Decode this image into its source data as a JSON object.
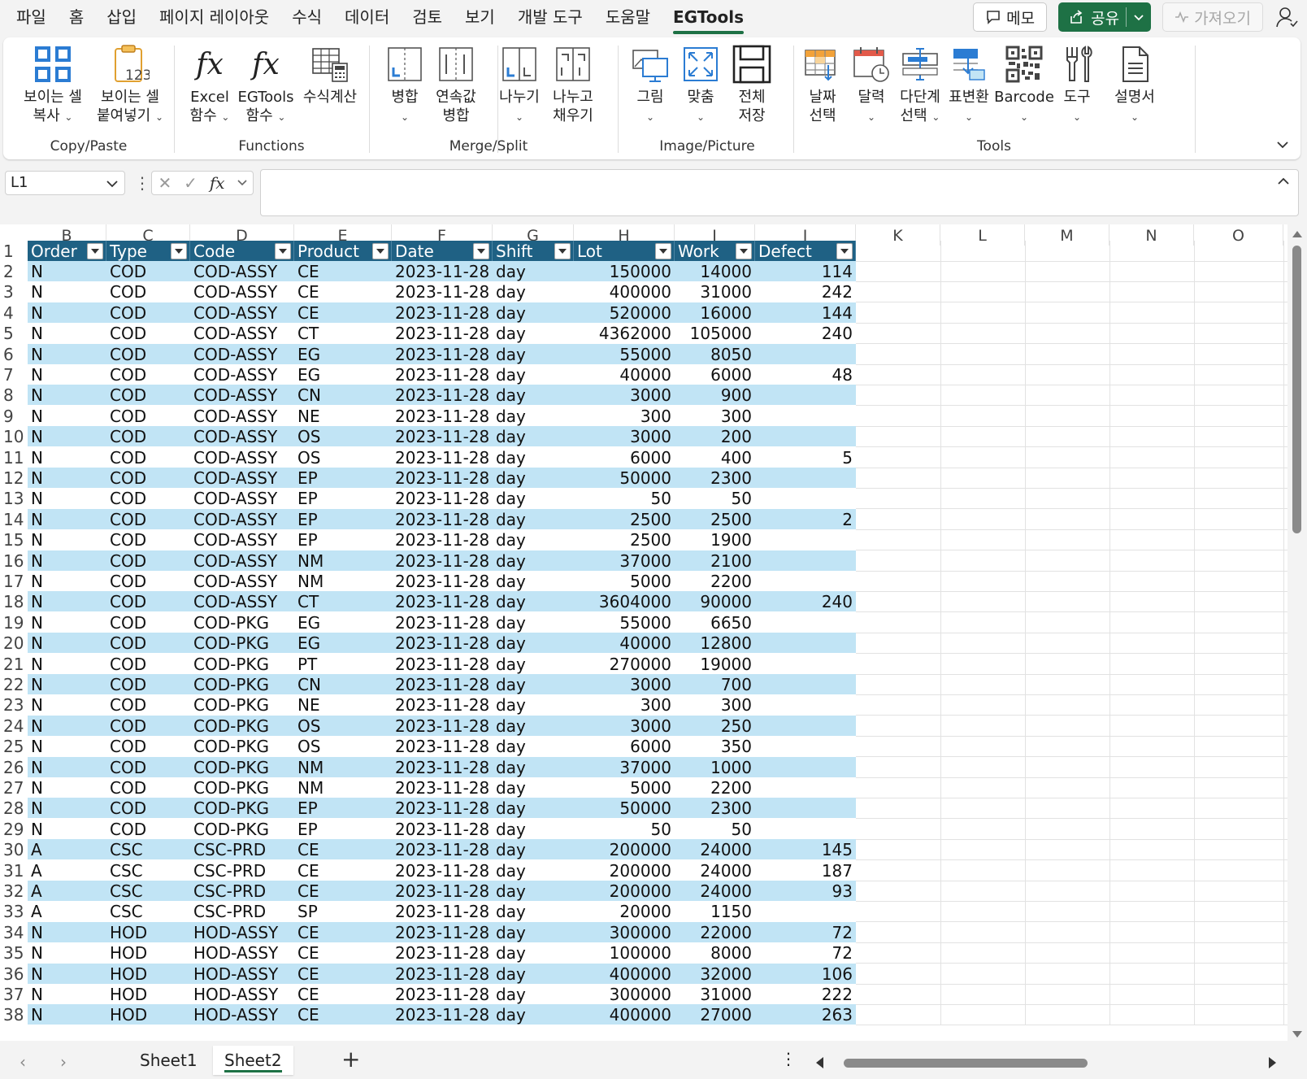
{
  "menu": {
    "tabs": [
      "파일",
      "홈",
      "삽입",
      "페이지 레이아웃",
      "수식",
      "데이터",
      "검토",
      "보기",
      "개발 도구",
      "도움말",
      "EGTools"
    ],
    "active": "EGTools",
    "memo": "메모",
    "share": "공유",
    "import": "가져오기"
  },
  "ribbon": {
    "groups": {
      "copy_paste": "Copy/Paste",
      "functions": "Functions",
      "merge_split": "Merge/Split",
      "image_picture": "Image/Picture",
      "tools": "Tools"
    },
    "buttons": {
      "copy_visible_1": "보이는 셀",
      "copy_visible_2": "복사",
      "paste_visible_1": "보이는 셀",
      "paste_visible_2": "붙여넣기",
      "excel_fn_1": "Excel",
      "excel_fn_2": "함수",
      "egtools_fn_1": "EGTools",
      "egtools_fn_2": "함수",
      "calc": "수식계산",
      "merge": "병합",
      "merge_series_1": "연속값",
      "merge_series_2": "병합",
      "split": "나누기",
      "split_fill_1": "나누고",
      "split_fill_2": "채우기",
      "picture": "그림",
      "fit": "맞춤",
      "save_all_1": "전체",
      "save_all_2": "저장",
      "date_pick_1": "날짜",
      "date_pick_2": "선택",
      "calendar": "달력",
      "multilevel_1": "다단계",
      "multilevel_2": "선택",
      "table_convert": "표변환",
      "barcode": "Barcode",
      "tool": "도구",
      "manual": "설명서"
    }
  },
  "formula_bar": {
    "name_box": "L1",
    "value": ""
  },
  "grid": {
    "columns": [
      "B",
      "C",
      "D",
      "E",
      "F",
      "G",
      "H",
      "I",
      "J",
      "K",
      "L",
      "M",
      "N",
      "O"
    ],
    "header_row_num": "1",
    "headers": [
      "Order",
      "Type",
      "Code",
      "Product",
      "Date",
      "Shift",
      "Lot",
      "Work",
      "Defect"
    ],
    "rows": [
      {
        "n": "2",
        "order": "N",
        "type": "COD",
        "code": "COD-ASSY",
        "product": "CE",
        "date": "2023-11-28",
        "shift": "day",
        "lot": "150000",
        "work": "14000",
        "defect": "114"
      },
      {
        "n": "3",
        "order": "N",
        "type": "COD",
        "code": "COD-ASSY",
        "product": "CE",
        "date": "2023-11-28",
        "shift": "day",
        "lot": "400000",
        "work": "31000",
        "defect": "242"
      },
      {
        "n": "4",
        "order": "N",
        "type": "COD",
        "code": "COD-ASSY",
        "product": "CE",
        "date": "2023-11-28",
        "shift": "day",
        "lot": "520000",
        "work": "16000",
        "defect": "144"
      },
      {
        "n": "5",
        "order": "N",
        "type": "COD",
        "code": "COD-ASSY",
        "product": "CT",
        "date": "2023-11-28",
        "shift": "day",
        "lot": "4362000",
        "work": "105000",
        "defect": "240"
      },
      {
        "n": "6",
        "order": "N",
        "type": "COD",
        "code": "COD-ASSY",
        "product": "EG",
        "date": "2023-11-28",
        "shift": "day",
        "lot": "55000",
        "work": "8050",
        "defect": ""
      },
      {
        "n": "7",
        "order": "N",
        "type": "COD",
        "code": "COD-ASSY",
        "product": "EG",
        "date": "2023-11-28",
        "shift": "day",
        "lot": "40000",
        "work": "6000",
        "defect": "48"
      },
      {
        "n": "8",
        "order": "N",
        "type": "COD",
        "code": "COD-ASSY",
        "product": "CN",
        "date": "2023-11-28",
        "shift": "day",
        "lot": "3000",
        "work": "900",
        "defect": ""
      },
      {
        "n": "9",
        "order": "N",
        "type": "COD",
        "code": "COD-ASSY",
        "product": "NE",
        "date": "2023-11-28",
        "shift": "day",
        "lot": "300",
        "work": "300",
        "defect": ""
      },
      {
        "n": "10",
        "order": "N",
        "type": "COD",
        "code": "COD-ASSY",
        "product": "OS",
        "date": "2023-11-28",
        "shift": "day",
        "lot": "3000",
        "work": "200",
        "defect": ""
      },
      {
        "n": "11",
        "order": "N",
        "type": "COD",
        "code": "COD-ASSY",
        "product": "OS",
        "date": "2023-11-28",
        "shift": "day",
        "lot": "6000",
        "work": "400",
        "defect": "5"
      },
      {
        "n": "12",
        "order": "N",
        "type": "COD",
        "code": "COD-ASSY",
        "product": "EP",
        "date": "2023-11-28",
        "shift": "day",
        "lot": "50000",
        "work": "2300",
        "defect": ""
      },
      {
        "n": "13",
        "order": "N",
        "type": "COD",
        "code": "COD-ASSY",
        "product": "EP",
        "date": "2023-11-28",
        "shift": "day",
        "lot": "50",
        "work": "50",
        "defect": ""
      },
      {
        "n": "14",
        "order": "N",
        "type": "COD",
        "code": "COD-ASSY",
        "product": "EP",
        "date": "2023-11-28",
        "shift": "day",
        "lot": "2500",
        "work": "2500",
        "defect": "2"
      },
      {
        "n": "15",
        "order": "N",
        "type": "COD",
        "code": "COD-ASSY",
        "product": "EP",
        "date": "2023-11-28",
        "shift": "day",
        "lot": "2500",
        "work": "1900",
        "defect": ""
      },
      {
        "n": "16",
        "order": "N",
        "type": "COD",
        "code": "COD-ASSY",
        "product": "NM",
        "date": "2023-11-28",
        "shift": "day",
        "lot": "37000",
        "work": "2100",
        "defect": ""
      },
      {
        "n": "17",
        "order": "N",
        "type": "COD",
        "code": "COD-ASSY",
        "product": "NM",
        "date": "2023-11-28",
        "shift": "day",
        "lot": "5000",
        "work": "2200",
        "defect": ""
      },
      {
        "n": "18",
        "order": "N",
        "type": "COD",
        "code": "COD-ASSY",
        "product": "CT",
        "date": "2023-11-28",
        "shift": "day",
        "lot": "3604000",
        "work": "90000",
        "defect": "240"
      },
      {
        "n": "19",
        "order": "N",
        "type": "COD",
        "code": "COD-PKG",
        "product": "EG",
        "date": "2023-11-28",
        "shift": "day",
        "lot": "55000",
        "work": "6650",
        "defect": ""
      },
      {
        "n": "20",
        "order": "N",
        "type": "COD",
        "code": "COD-PKG",
        "product": "EG",
        "date": "2023-11-28",
        "shift": "day",
        "lot": "40000",
        "work": "12800",
        "defect": ""
      },
      {
        "n": "21",
        "order": "N",
        "type": "COD",
        "code": "COD-PKG",
        "product": "PT",
        "date": "2023-11-28",
        "shift": "day",
        "lot": "270000",
        "work": "19000",
        "defect": ""
      },
      {
        "n": "22",
        "order": "N",
        "type": "COD",
        "code": "COD-PKG",
        "product": "CN",
        "date": "2023-11-28",
        "shift": "day",
        "lot": "3000",
        "work": "700",
        "defect": ""
      },
      {
        "n": "23",
        "order": "N",
        "type": "COD",
        "code": "COD-PKG",
        "product": "NE",
        "date": "2023-11-28",
        "shift": "day",
        "lot": "300",
        "work": "300",
        "defect": ""
      },
      {
        "n": "24",
        "order": "N",
        "type": "COD",
        "code": "COD-PKG",
        "product": "OS",
        "date": "2023-11-28",
        "shift": "day",
        "lot": "3000",
        "work": "250",
        "defect": ""
      },
      {
        "n": "25",
        "order": "N",
        "type": "COD",
        "code": "COD-PKG",
        "product": "OS",
        "date": "2023-11-28",
        "shift": "day",
        "lot": "6000",
        "work": "350",
        "defect": ""
      },
      {
        "n": "26",
        "order": "N",
        "type": "COD",
        "code": "COD-PKG",
        "product": "NM",
        "date": "2023-11-28",
        "shift": "day",
        "lot": "37000",
        "work": "1000",
        "defect": ""
      },
      {
        "n": "27",
        "order": "N",
        "type": "COD",
        "code": "COD-PKG",
        "product": "NM",
        "date": "2023-11-28",
        "shift": "day",
        "lot": "5000",
        "work": "2200",
        "defect": ""
      },
      {
        "n": "28",
        "order": "N",
        "type": "COD",
        "code": "COD-PKG",
        "product": "EP",
        "date": "2023-11-28",
        "shift": "day",
        "lot": "50000",
        "work": "2300",
        "defect": ""
      },
      {
        "n": "29",
        "order": "N",
        "type": "COD",
        "code": "COD-PKG",
        "product": "EP",
        "date": "2023-11-28",
        "shift": "day",
        "lot": "50",
        "work": "50",
        "defect": ""
      },
      {
        "n": "30",
        "order": "A",
        "type": "CSC",
        "code": "CSC-PRD",
        "product": "CE",
        "date": "2023-11-28",
        "shift": "day",
        "lot": "200000",
        "work": "24000",
        "defect": "145"
      },
      {
        "n": "31",
        "order": "A",
        "type": "CSC",
        "code": "CSC-PRD",
        "product": "CE",
        "date": "2023-11-28",
        "shift": "day",
        "lot": "200000",
        "work": "24000",
        "defect": "187"
      },
      {
        "n": "32",
        "order": "A",
        "type": "CSC",
        "code": "CSC-PRD",
        "product": "CE",
        "date": "2023-11-28",
        "shift": "day",
        "lot": "200000",
        "work": "24000",
        "defect": "93"
      },
      {
        "n": "33",
        "order": "A",
        "type": "CSC",
        "code": "CSC-PRD",
        "product": "SP",
        "date": "2023-11-28",
        "shift": "day",
        "lot": "20000",
        "work": "1150",
        "defect": ""
      },
      {
        "n": "34",
        "order": "N",
        "type": "HOD",
        "code": "HOD-ASSY",
        "product": "CE",
        "date": "2023-11-28",
        "shift": "day",
        "lot": "300000",
        "work": "22000",
        "defect": "72"
      },
      {
        "n": "35",
        "order": "N",
        "type": "HOD",
        "code": "HOD-ASSY",
        "product": "CE",
        "date": "2023-11-28",
        "shift": "day",
        "lot": "100000",
        "work": "8000",
        "defect": "72"
      },
      {
        "n": "36",
        "order": "N",
        "type": "HOD",
        "code": "HOD-ASSY",
        "product": "CE",
        "date": "2023-11-28",
        "shift": "day",
        "lot": "400000",
        "work": "32000",
        "defect": "106"
      },
      {
        "n": "37",
        "order": "N",
        "type": "HOD",
        "code": "HOD-ASSY",
        "product": "CE",
        "date": "2023-11-28",
        "shift": "day",
        "lot": "300000",
        "work": "31000",
        "defect": "222"
      },
      {
        "n": "38",
        "order": "N",
        "type": "HOD",
        "code": "HOD-ASSY",
        "product": "CE",
        "date": "2023-11-28",
        "shift": "day",
        "lot": "400000",
        "work": "27000",
        "defect": "263"
      }
    ]
  },
  "sheets": {
    "tabs": [
      "Sheet1",
      "Sheet2"
    ],
    "active": "Sheet2"
  },
  "colors": {
    "accent": "#1e7145",
    "table_header": "#1f6184",
    "band": "#c1e4f5"
  }
}
